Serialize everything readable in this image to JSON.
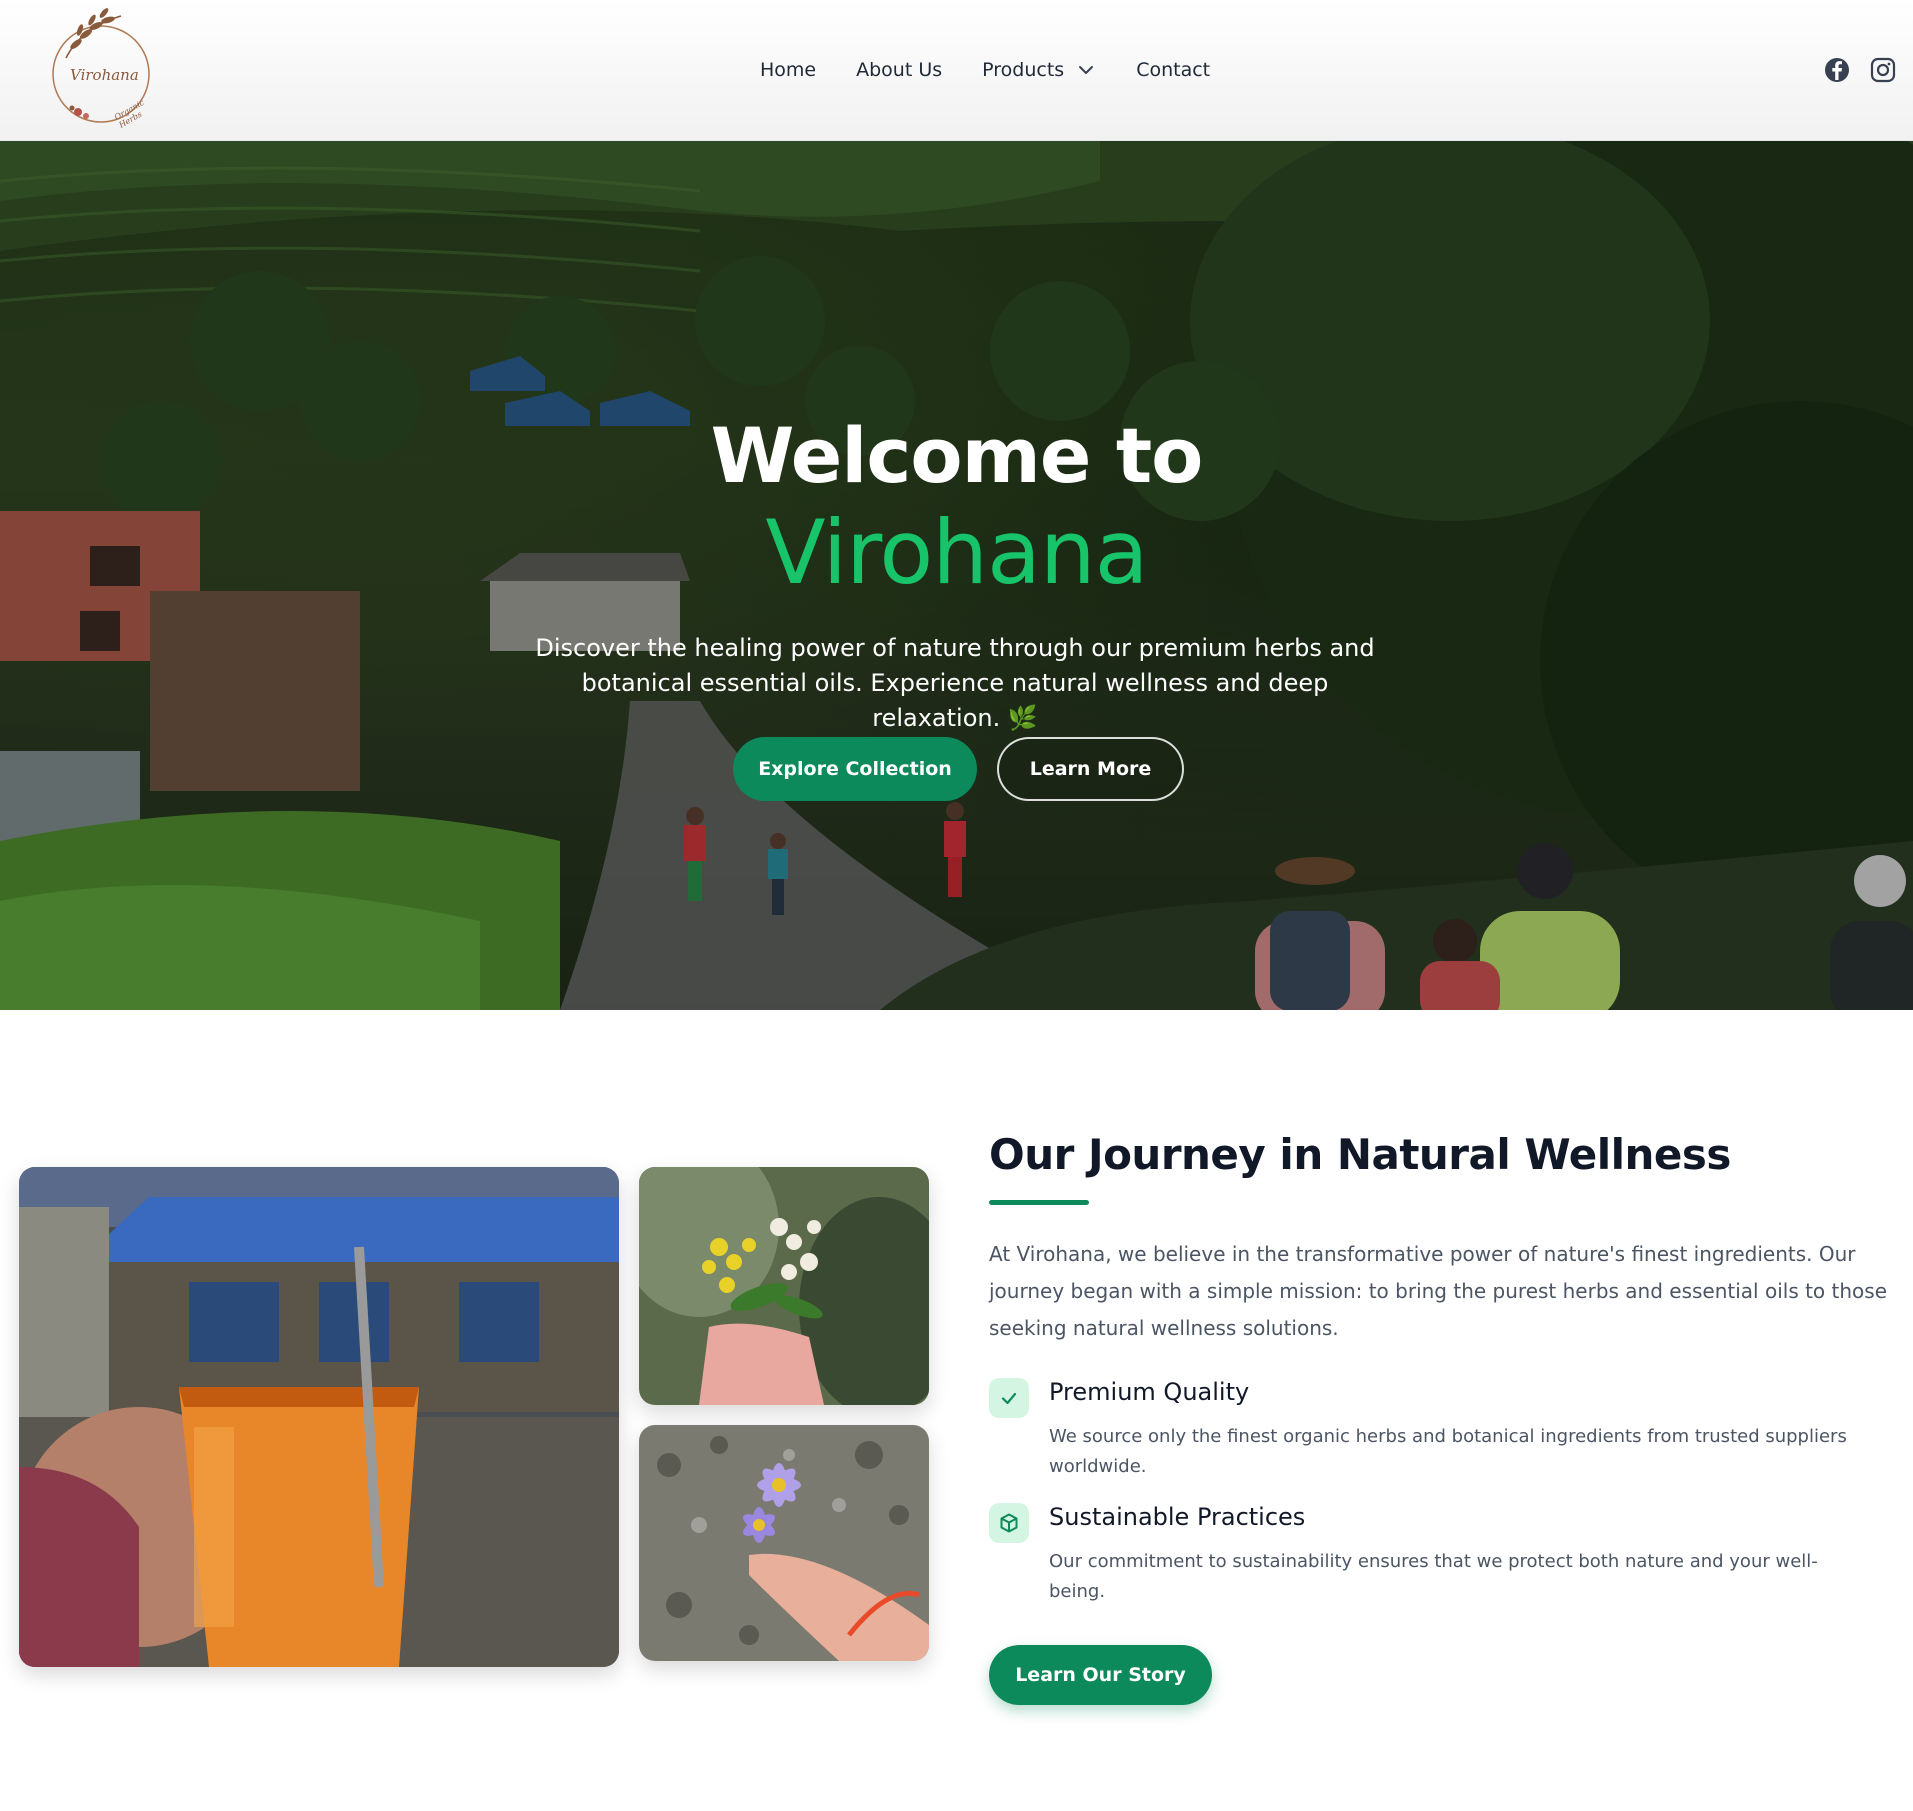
{
  "brand": {
    "logo_text": "Virohana",
    "logo_sub": "Organic Herbs"
  },
  "nav": {
    "items": [
      "Home",
      "About Us",
      "Products",
      "Contact"
    ]
  },
  "social": {
    "icons": [
      "facebook-icon",
      "instagram-icon"
    ]
  },
  "hero": {
    "title_line1": "Welcome to",
    "title_line2": "Virohana",
    "description": "Discover the healing power of nature through our premium herbs and botanical essential oils. Experience natural wellness and deep relaxation.",
    "leaf_glyph": "🌿",
    "primary_button": "Explore Collection",
    "secondary_button": "Learn More"
  },
  "journey": {
    "title": "Our Journey in Natural Wellness",
    "body": "At Virohana, we believe in the transformative power of nature's finest ingredients. Our journey began with a simple mission: to bring the purest herbs and essential oils to those seeking natural wellness solutions.",
    "features": [
      {
        "icon": "check-icon",
        "title": "Premium Quality",
        "text": "We source only the finest organic herbs and botanical ingredients from trusted suppliers worldwide."
      },
      {
        "icon": "box-icon",
        "title": "Sustainable Practices",
        "text": "Our commitment to sustainability ensures that we protect both nature and your well-being."
      }
    ],
    "button": "Learn Our Story"
  },
  "colors": {
    "accent": "#0c8a5c",
    "hero_highlight": "#17c46a",
    "heading": "#111827",
    "body_text": "#4b5563",
    "icon_bg": "#d5f5e3"
  }
}
